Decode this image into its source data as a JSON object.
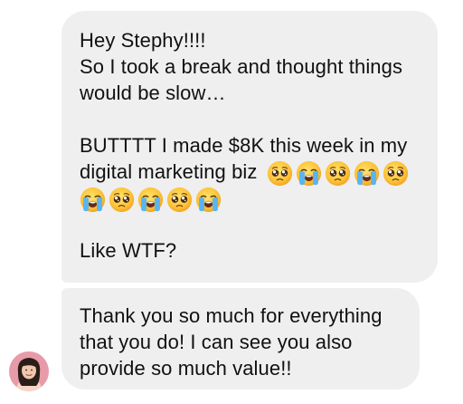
{
  "messages": [
    {
      "line1": "Hey Stephy!!!!",
      "line2": "So I took a break and thought things",
      "line3": "would be slow…",
      "line4": "BUTTTT I made $8K this week in my",
      "line5": "digital marketing biz",
      "line5_emojis": [
        "pleading-face-emoji",
        "loudly-crying-face-emoji",
        "pleading-face-emoji",
        "loudly-crying-face-emoji",
        "pleading-face-emoji"
      ],
      "line6_emojis": [
        "loudly-crying-face-emoji",
        "pleading-face-emoji",
        "loudly-crying-face-emoji",
        "pleading-face-emoji",
        "loudly-crying-face-emoji"
      ],
      "line7": "Like WTF?"
    },
    {
      "line1": "Thank you so much for everything",
      "line2": "that you do! I can see you also",
      "line3": "provide so much value!!"
    }
  ],
  "colors": {
    "bubble_bg": "#efefef",
    "text": "#111111",
    "avatar_bg": "#e79aa8"
  },
  "icons": {
    "avatar": "sender-avatar"
  }
}
